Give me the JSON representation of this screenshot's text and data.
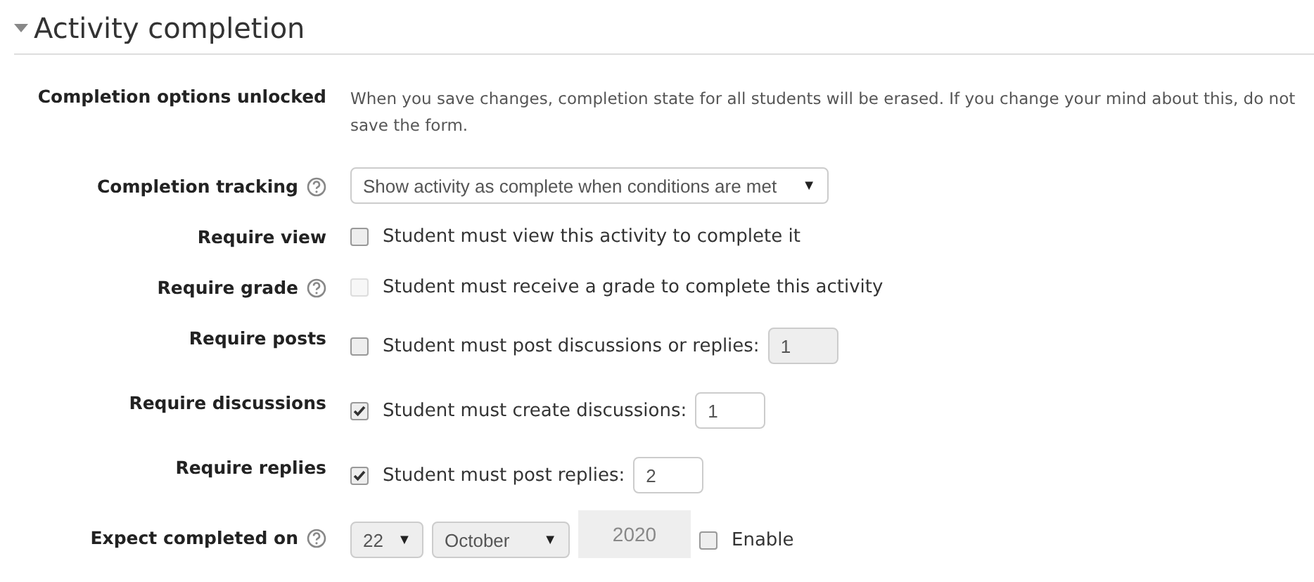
{
  "section": {
    "title": "Activity completion",
    "expanded": true
  },
  "rows": [
    {
      "kind": "note",
      "label": "Completion options unlocked",
      "help": false,
      "text": "When you save changes, completion state for all students will be erased. If you change your mind about this, do not save the form."
    },
    {
      "kind": "select",
      "label": "Completion tracking",
      "help": true,
      "value": "Show activity as complete when conditions are met",
      "caret": "▼"
    },
    {
      "kind": "checkbox",
      "label": "Require view",
      "help": false,
      "checked": false,
      "disabled": false,
      "text": "Student must view this activity to complete it"
    },
    {
      "kind": "checkbox",
      "label": "Require grade",
      "help": true,
      "checked": false,
      "disabled": true,
      "text": "Student must receive a grade to complete this activity"
    },
    {
      "kind": "checkbox_number",
      "label": "Require posts",
      "help": false,
      "checked": false,
      "text": "Student must post discussions or replies:",
      "value": "1"
    },
    {
      "kind": "checkbox_number",
      "label": "Require discussions",
      "help": false,
      "checked": true,
      "text": "Student must create discussions:",
      "value": "1"
    },
    {
      "kind": "checkbox_number",
      "label": "Require replies",
      "help": false,
      "checked": true,
      "text": "Student must post replies:",
      "value": "2"
    },
    {
      "kind": "date",
      "label": "Expect completed on",
      "help": true,
      "day": "22",
      "month": "October",
      "year": "2020",
      "caret": "▼",
      "enabled": false,
      "enable_label": "Enable"
    }
  ]
}
